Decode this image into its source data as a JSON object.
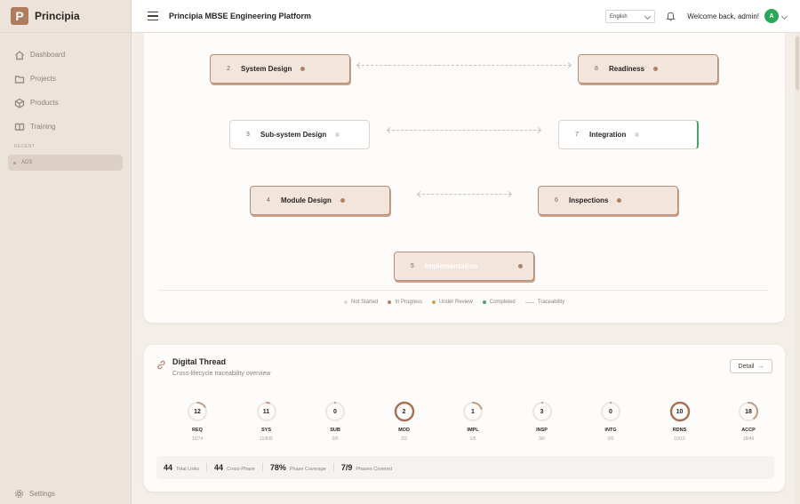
{
  "brand": {
    "logo_letter": "P",
    "name": "Principia"
  },
  "sidebar": {
    "items": [
      {
        "label": "Dashboard",
        "icon": "home-icon"
      },
      {
        "label": "Projects",
        "icon": "folder-icon"
      },
      {
        "label": "Products",
        "icon": "cube-icon"
      },
      {
        "label": "Training",
        "icon": "book-icon"
      }
    ],
    "recent_label": "RECENT",
    "recent_items": [
      {
        "label": "ADS"
      }
    ],
    "settings_label": "Settings"
  },
  "header": {
    "title": "Principia MBSE Engineering Platform",
    "language": "English",
    "welcome": "Welcome back, admin!",
    "avatar_letter": "A"
  },
  "phases": {
    "nodes": [
      {
        "num": "2",
        "label": "System Design",
        "state": "in-progress"
      },
      {
        "num": "8",
        "label": "Readiness",
        "state": "in-progress"
      },
      {
        "num": "3",
        "label": "Sub-system Design",
        "state": "not-started"
      },
      {
        "num": "7",
        "label": "Integration",
        "state": "not-started"
      },
      {
        "num": "4",
        "label": "Module Design",
        "state": "in-progress"
      },
      {
        "num": "6",
        "label": "Inspections",
        "state": "in-progress"
      },
      {
        "num": "5",
        "label": "Implementation",
        "state": "in-progress"
      }
    ],
    "legend": [
      {
        "label": "Not Started",
        "color": "#e1dad3"
      },
      {
        "label": "In Progress",
        "color": "#b48064"
      },
      {
        "label": "Under Review",
        "color": "#d4a44a"
      },
      {
        "label": "Completed",
        "color": "#4fa06a"
      },
      {
        "label": "Traceability",
        "color": "#cfc6bd"
      }
    ]
  },
  "thread": {
    "title": "Digital Thread",
    "subtitle": "Cross-lifecycle traceability overview",
    "detail_label": "Detail",
    "metrics": [
      {
        "value": "12",
        "code": "REQ",
        "frac": "12/74",
        "ratio": 0.162
      },
      {
        "value": "11",
        "code": "SYS",
        "frac": "11/835",
        "ratio": 0.013
      },
      {
        "value": "0",
        "code": "SUB",
        "frac": "0/0",
        "ratio": 0
      },
      {
        "value": "2",
        "code": "MOD",
        "frac": "2/2",
        "ratio": 1
      },
      {
        "value": "1",
        "code": "IMPL",
        "frac": "1/5",
        "ratio": 0.2
      },
      {
        "value": "3",
        "code": "INSP",
        "frac": "3/0",
        "ratio": 0
      },
      {
        "value": "0",
        "code": "INTG",
        "frac": "0/0",
        "ratio": 0
      },
      {
        "value": "10",
        "code": "RDNS",
        "frac": "10/10",
        "ratio": 1
      },
      {
        "value": "18",
        "code": "ACCP",
        "frac": "18/46",
        "ratio": 0.39
      }
    ],
    "summary": [
      {
        "value": "44",
        "label": "Total Links"
      },
      {
        "value": "44",
        "label": "Cross-Phase"
      },
      {
        "value": "78%",
        "label": "Phase Coverage"
      },
      {
        "value": "7/9",
        "label": "Phases Covered"
      }
    ]
  }
}
